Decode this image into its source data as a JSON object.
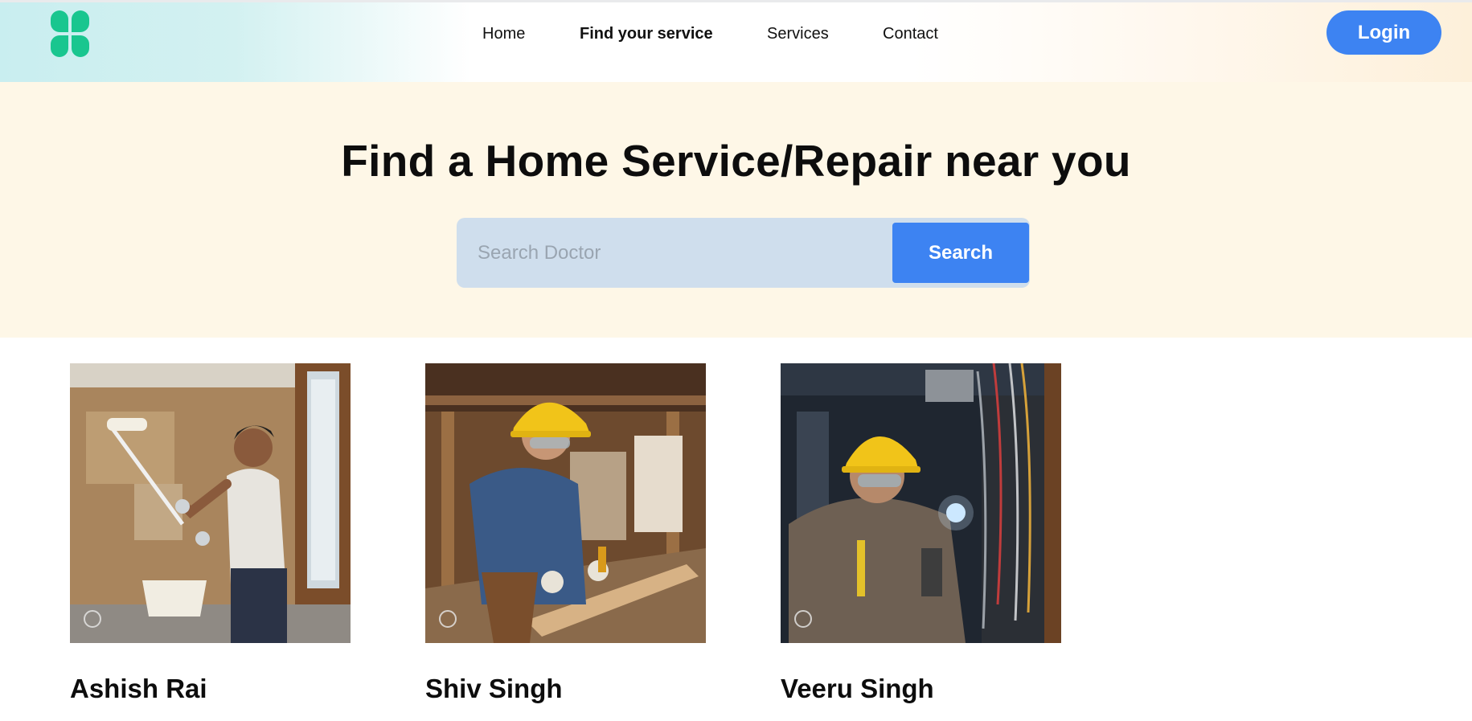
{
  "header": {
    "logo_icon": "four-leaf-logo-icon",
    "brand_color": "#19c68f",
    "nav": [
      {
        "label": "Home",
        "active": false
      },
      {
        "label": "Find your service",
        "active": true
      },
      {
        "label": "Services",
        "active": false
      },
      {
        "label": "Contact",
        "active": false
      }
    ],
    "login_label": "Login"
  },
  "hero": {
    "title": "Find a Home Service/Repair near you",
    "search": {
      "placeholder": "Search Doctor",
      "value": "",
      "button_label": "Search"
    }
  },
  "providers": [
    {
      "name": "Ashish Rai",
      "photo": "painter-photo"
    },
    {
      "name": "Shiv Singh",
      "photo": "carpenter-photo"
    },
    {
      "name": "Veeru Singh",
      "photo": "electrician-photo"
    }
  ],
  "colors": {
    "accent": "#3d83f2",
    "hero_bg": "#fef7e7",
    "search_bg": "#cfdeed"
  }
}
